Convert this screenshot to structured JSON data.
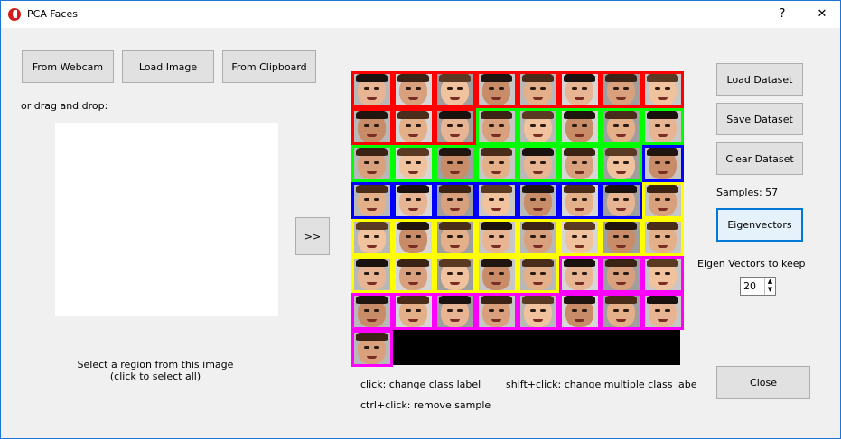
{
  "window": {
    "title": "PCA Faces",
    "help_label": "?",
    "close_label": "✕"
  },
  "input": {
    "webcam_label": "From Webcam",
    "load_image_label": "Load Image",
    "clipboard_label": "From Clipboard",
    "drag_label": "or drag and drop:",
    "select_hint_line1": "Select a region from this image",
    "select_hint_line2": "(click to select all)",
    "transfer_label": ">>"
  },
  "dataset": {
    "colors": {
      "class1": "#ff0000",
      "class2": "#00ff00",
      "class3": "#0000ff",
      "class4": "#ffff00",
      "class5": "#ff00ff"
    },
    "sample_count": 57,
    "hint_click": "click: change class label",
    "hint_shift": "shift+click: change multiple class labe",
    "hint_ctrl": "ctrl+click: remove sample"
  },
  "controls": {
    "load_label": "Load Dataset",
    "save_label": "Save Dataset",
    "clear_label": "Clear Dataset",
    "samples_label": "Samples: 57",
    "eigen_label": "Eigenvectors",
    "keep_label": "Eigen Vectors to keep",
    "keep_value": "20",
    "close_label": "Close"
  }
}
